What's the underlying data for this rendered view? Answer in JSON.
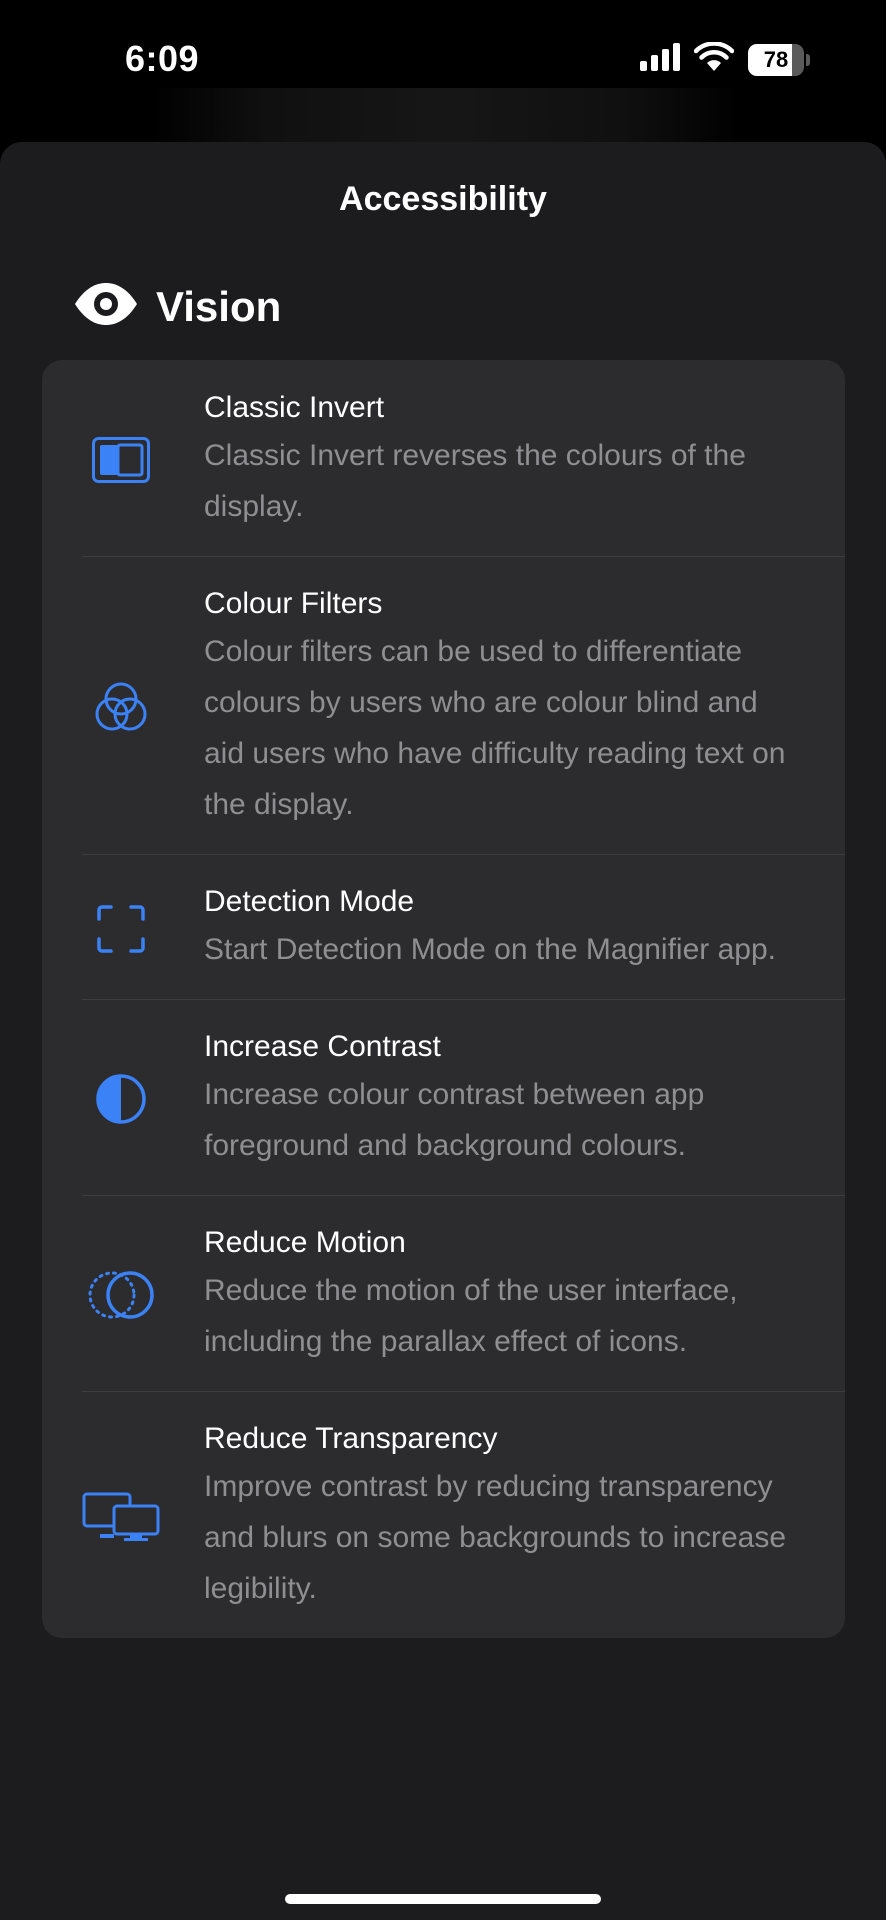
{
  "status_bar": {
    "time": "6:09",
    "battery": "78",
    "battery_level_percent": 78,
    "icons": [
      "signal-icon",
      "wifi-icon",
      "battery-icon"
    ]
  },
  "sheet": {
    "title": "Accessibility"
  },
  "section": {
    "icon": "eye-icon",
    "title": "Vision"
  },
  "accent_color": "#3b82f6",
  "items": [
    {
      "icon": "classic-invert-icon",
      "title": "Classic Invert",
      "description": "Classic Invert reverses the colours of the display."
    },
    {
      "icon": "colour-filters-icon",
      "title": "Colour Filters",
      "description": "Colour filters can be used to differentiate colours by users who are colour blind and aid users who have difficulty reading text on the display."
    },
    {
      "icon": "detection-mode-icon",
      "title": "Detection Mode",
      "description": "Start Detection Mode on the Magnifier app."
    },
    {
      "icon": "increase-contrast-icon",
      "title": "Increase Contrast",
      "description": "Increase colour contrast between app foreground and background colours."
    },
    {
      "icon": "reduce-motion-icon",
      "title": "Reduce Motion",
      "description": "Reduce the motion of the user interface, including the parallax effect of icons."
    },
    {
      "icon": "reduce-transparency-icon",
      "title": "Reduce Transparency",
      "description": "Improve contrast by reducing transparency and blurs on some backgrounds to increase legibility."
    }
  ]
}
